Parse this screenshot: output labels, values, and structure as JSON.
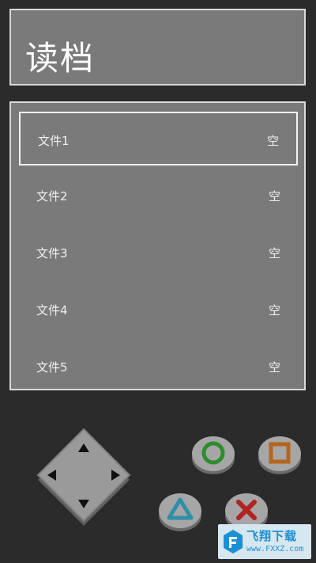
{
  "header": {
    "title": "读档"
  },
  "save_slots": [
    {
      "name": "文件1",
      "status": "空",
      "selected": true
    },
    {
      "name": "文件2",
      "status": "空",
      "selected": false
    },
    {
      "name": "文件3",
      "status": "空",
      "selected": false
    },
    {
      "name": "文件4",
      "status": "空",
      "selected": false
    },
    {
      "name": "文件5",
      "status": "空",
      "selected": false
    }
  ],
  "controls": {
    "dpad_icon": "dpad-icon",
    "circle_icon": "circle-icon",
    "square_icon": "square-icon",
    "triangle_icon": "triangle-icon",
    "cross_icon": "cross-icon",
    "colors": {
      "circle": "#2e8b2e",
      "square": "#b5651d",
      "triangle": "#2f8fa8",
      "cross": "#b22222"
    }
  },
  "watermark": {
    "text": "飞翔下载",
    "url": "www.FXXZ.com"
  }
}
